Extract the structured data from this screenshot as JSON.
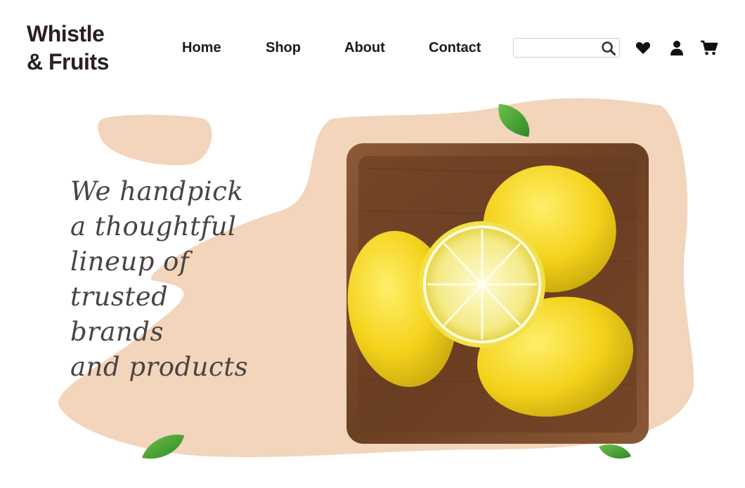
{
  "brand": {
    "line1": "Whistle",
    "line2": "& Fruits"
  },
  "nav": {
    "home": "Home",
    "shop": "Shop",
    "about": "About",
    "contact": "Contact"
  },
  "search": {
    "value": "",
    "placeholder": ""
  },
  "icons": {
    "search": "search-icon",
    "wishlist": "heart-icon",
    "account": "user-icon",
    "cart": "cart-icon"
  },
  "hero": {
    "lines": [
      "We handpick",
      "a thoughtful",
      "lineup of",
      "trusted",
      "brands",
      "and products"
    ]
  },
  "colors": {
    "blob": "#f2d5bb",
    "text": "#4a4345",
    "brand": "#2b1f1f",
    "lemon": "#f5d826",
    "bowl": "#7a4a2a",
    "leaf": "#3e9b2f"
  }
}
